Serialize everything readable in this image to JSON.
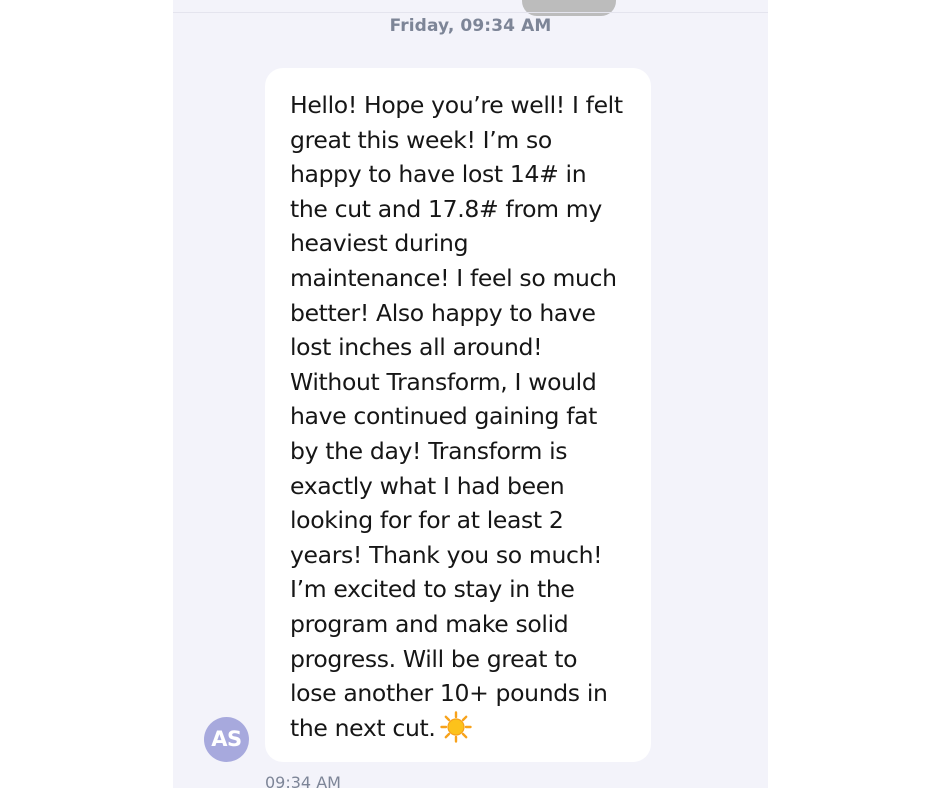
{
  "conversation": {
    "date_header": "Friday, 09:34 AM"
  },
  "message": {
    "sender_initials": "AS",
    "lines": [
      "Hello! Hope you’re well! I felt",
      "great this week! I’m so",
      "happy to have lost 14# in",
      "the cut and 17.8# from my",
      "heaviest during",
      "maintenance! I feel so much",
      "better! Also happy to have",
      "lost inches all around!",
      "Without Transform, I would",
      "have continued gaining fat",
      "by the day! Transform is",
      "exactly what I had been",
      "looking for for at least 2",
      "years! Thank you so much!",
      "I’m excited to stay in the",
      "program and make solid",
      "progress. Will be great to",
      "lose another 10+ pounds in",
      "the next cut."
    ],
    "emoji_icon": "sun-icon",
    "timestamp": "09:34 AM"
  },
  "colors": {
    "panel_background": "#f3f3fa",
    "bubble_background": "#ffffff",
    "avatar_background": "#a7a9dd",
    "meta_text": "#7d8597"
  }
}
